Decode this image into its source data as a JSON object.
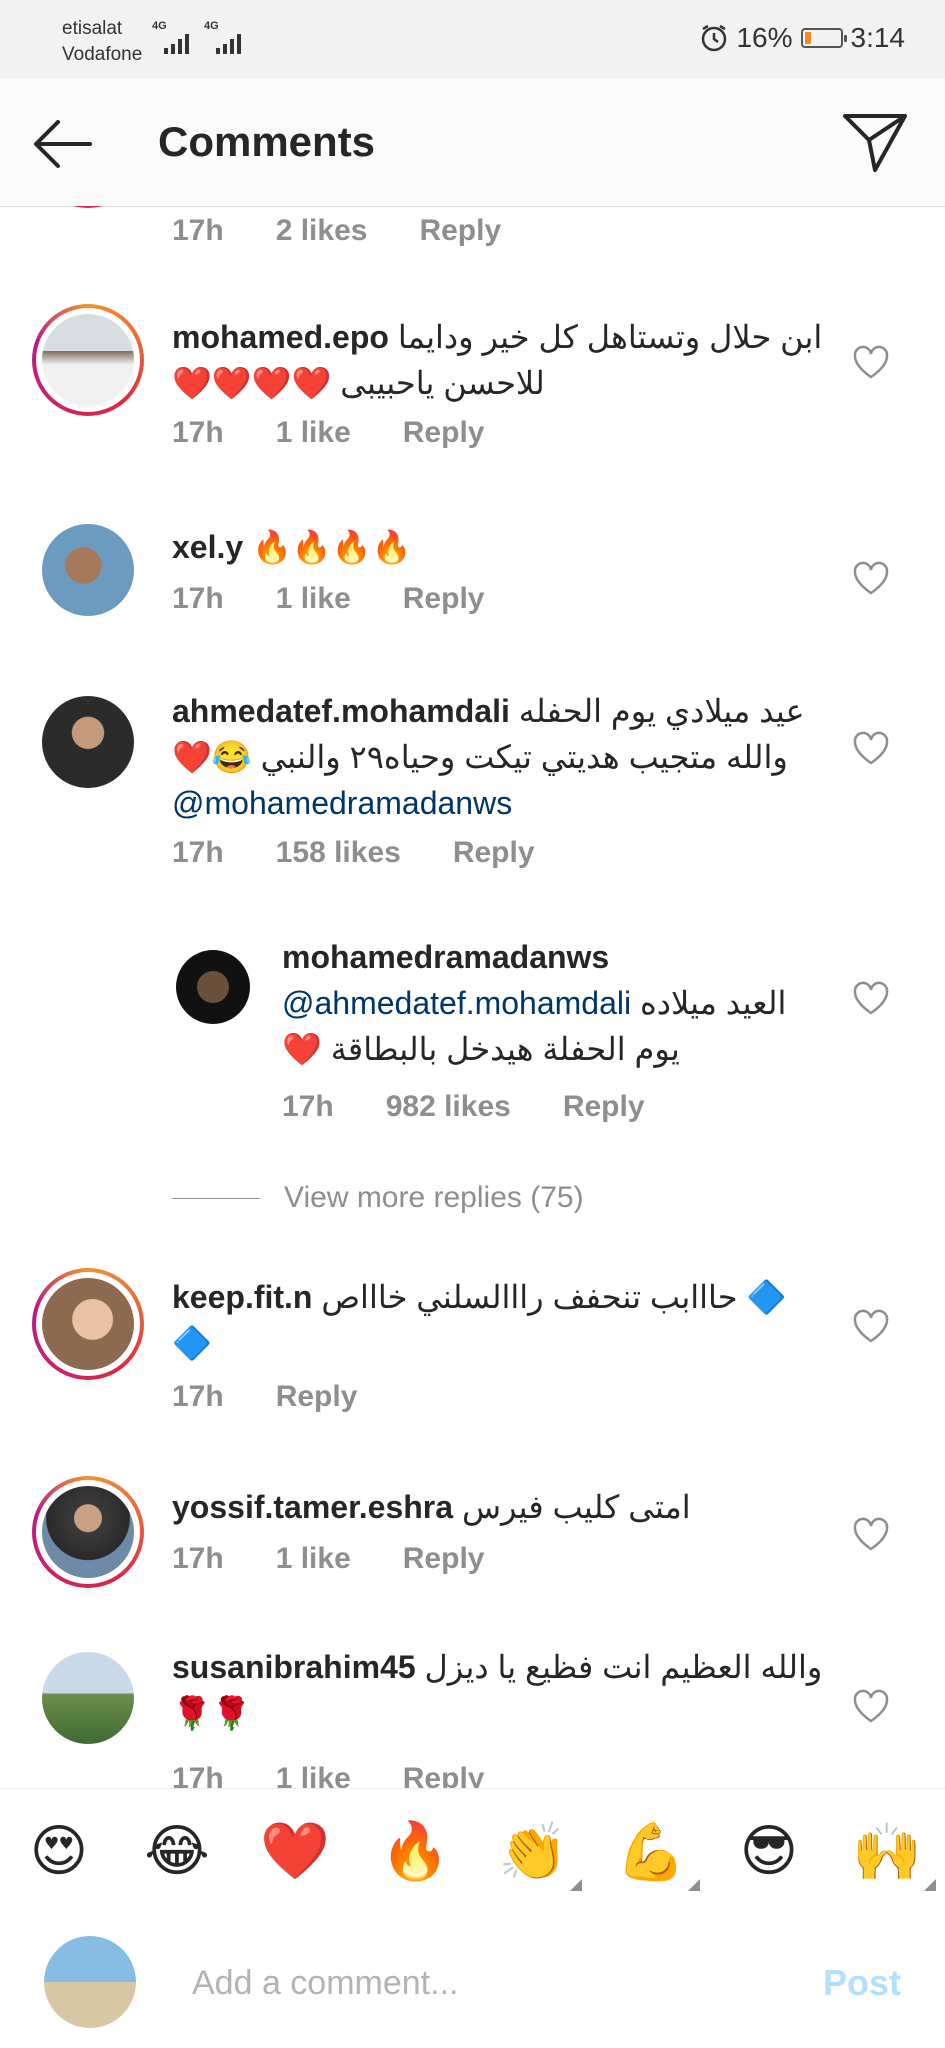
{
  "status": {
    "carrier1": "etisalat",
    "carrier2": "Vodafone",
    "net1": "4G",
    "net2": "4G",
    "battery": "16%",
    "time": "3:14",
    "battery_color": "#f28b1b"
  },
  "header": {
    "title": "Comments",
    "back_icon": "arrow-left-icon",
    "send_icon": "paper-plane-icon"
  },
  "prev_comment": {
    "time": "17h",
    "likes": "2 likes",
    "reply": "Reply"
  },
  "comments": [
    {
      "username": "mohamed.epo",
      "text": "ابن حلال وتستاهل كل خير ودايما للاحسن ياحبيبى ❤️❤️❤️❤️",
      "time": "17h",
      "likes": "1 like",
      "reply": "Reply"
    },
    {
      "username": "xel.y",
      "text": "🔥🔥🔥🔥",
      "time": "17h",
      "likes": "1 like",
      "reply": "Reply"
    },
    {
      "username": "ahmedatef.mohamdali",
      "text": "عيد ميلادي يوم الحفله والله متجيب هديتي تيكت وحياه٢٩ والنبي 😂❤️",
      "mention": "@mohamedramadanws",
      "time": "17h",
      "likes": "158 likes",
      "reply": "Reply"
    },
    {
      "username": "mohamedramadanws",
      "mention": "@ahmedatef.mohamdali",
      "text": "العيد ميلاده يوم الحفلة هيدخل بالبطاقة ❤️",
      "time": "17h",
      "likes": "982 likes",
      "reply": "Reply"
    },
    {
      "username": "keep.fit.n",
      "text": "🔷 حااابب  تنحفف رااالسلني خاااص 🔷",
      "time": "17h",
      "reply": "Reply"
    },
    {
      "username": "yossif.tamer.eshra",
      "text": "امتى كليب فيرس",
      "time": "17h",
      "likes": "1 like",
      "reply": "Reply"
    },
    {
      "username": "susanibrahim45",
      "text": "والله العظيم انت فظيع يا ديزل 🌹🌹",
      "time": "17h",
      "likes": "1 like",
      "reply": "Reply"
    }
  ],
  "view_more": "View more replies (75)",
  "reactions": [
    "😍",
    "😂",
    "❤️",
    "🔥",
    "👏",
    "💪",
    "😎",
    "🙌"
  ],
  "composer": {
    "placeholder": "Add a comment...",
    "post_label": "Post",
    "post_color": "#b2dffc"
  }
}
